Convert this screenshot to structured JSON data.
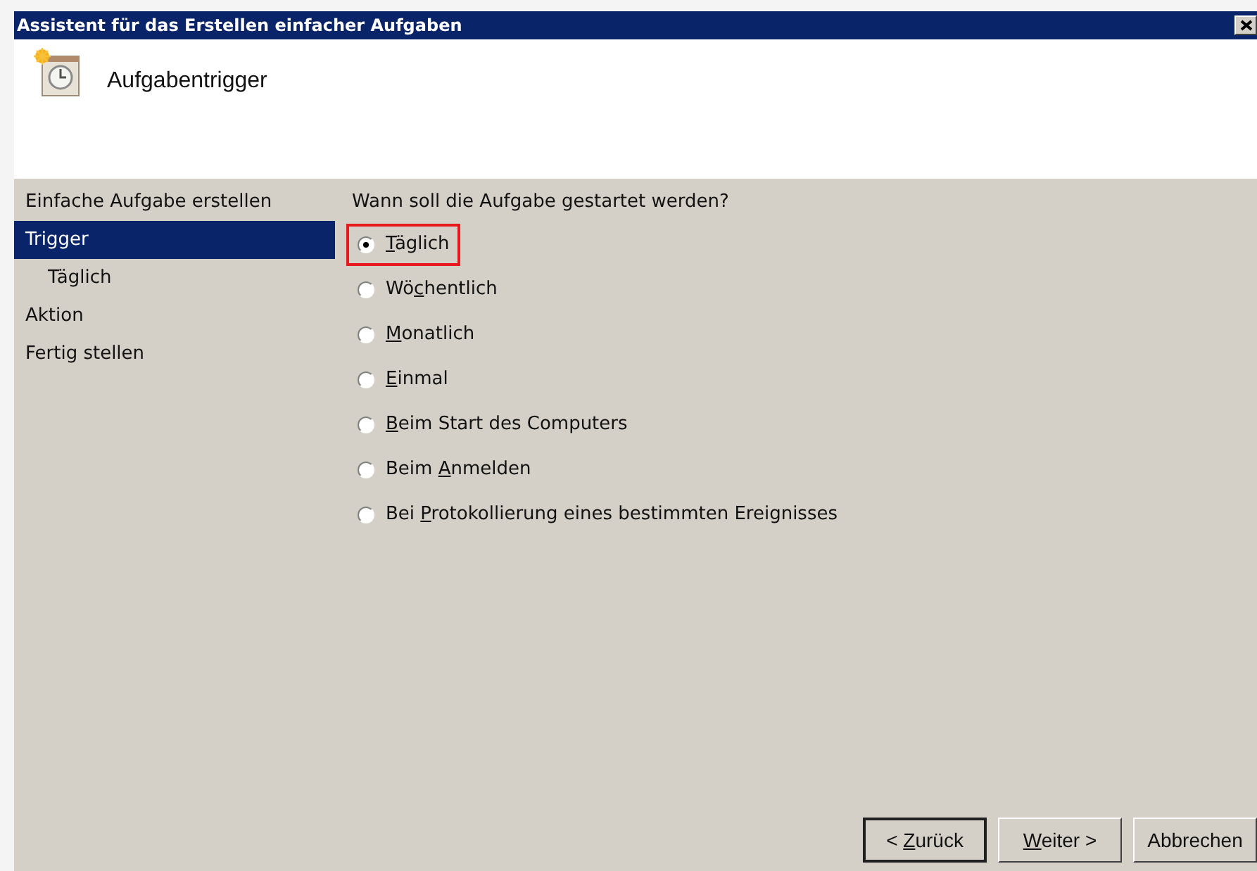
{
  "window": {
    "title": "Assistent für das Erstellen einfacher Aufgaben"
  },
  "header": {
    "title": "Aufgabentrigger"
  },
  "sidebar": {
    "items": [
      {
        "label": "Einfache Aufgabe erstellen",
        "selected": false
      },
      {
        "label": "Trigger",
        "selected": true,
        "children": [
          {
            "label": "Täglich",
            "selected": false
          }
        ]
      },
      {
        "label": "Aktion",
        "selected": false
      },
      {
        "label": "Fertig stellen",
        "selected": false
      }
    ]
  },
  "question": "Wann soll die Aufgabe gestartet werden?",
  "options": [
    {
      "key": "T",
      "post": "äglich",
      "selected": true,
      "highlighted": true
    },
    {
      "pre": "Wö",
      "key": "c",
      "post": "hentlich",
      "selected": false,
      "highlighted": false
    },
    {
      "key": "M",
      "post": "onatlich",
      "selected": false,
      "highlighted": false
    },
    {
      "key": "E",
      "post": "inmal",
      "selected": false,
      "highlighted": false
    },
    {
      "key": "B",
      "post": "eim Start des Computers",
      "selected": false,
      "highlighted": false
    },
    {
      "pre": "Beim ",
      "key": "A",
      "post": "nmelden",
      "selected": false,
      "highlighted": false
    },
    {
      "pre": "Bei ",
      "key": "P",
      "post": "rotokollierung eines bestimmten Ereignisses",
      "selected": false,
      "highlighted": false
    }
  ],
  "buttons": [
    {
      "pre": "< ",
      "key": "Z",
      "post": "urück",
      "default": true
    },
    {
      "key": "W",
      "post": "eiter >",
      "default": false
    },
    {
      "post": "Abbrechen",
      "default": false
    }
  ]
}
